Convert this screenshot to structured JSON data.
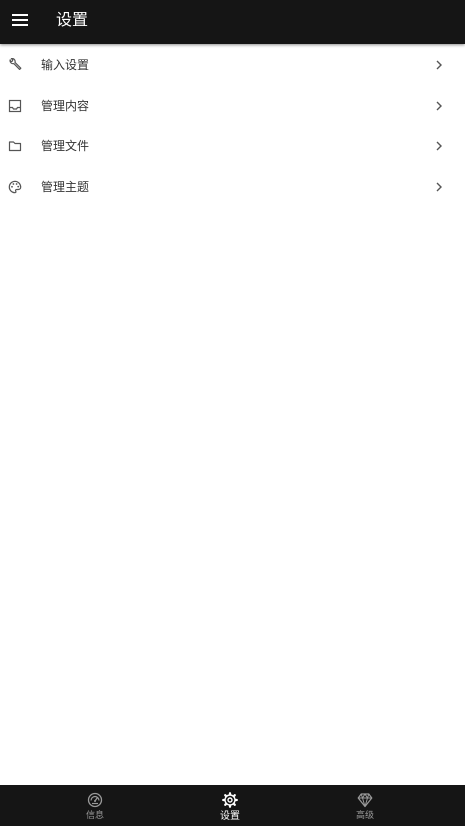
{
  "app_bar": {
    "title": "设置",
    "menu_icon": "hamburger-menu-icon"
  },
  "settings": {
    "items": [
      {
        "label": "输入设置",
        "icon": "wrench-icon"
      },
      {
        "label": "管理内容",
        "icon": "inbox-tray-icon"
      },
      {
        "label": "管理文件",
        "icon": "folder-icon"
      },
      {
        "label": "管理主题",
        "icon": "palette-icon"
      }
    ],
    "chevron_icon": "chevron-right-icon"
  },
  "bottom_nav": {
    "tabs": [
      {
        "label": "信息",
        "icon": "speedometer-icon",
        "active": false
      },
      {
        "label": "设置",
        "icon": "gear-icon",
        "active": true
      },
      {
        "label": "高级",
        "icon": "diamond-icon",
        "active": false
      }
    ]
  },
  "colors": {
    "bar_background": "#151515",
    "page_background": "#ffffff",
    "text_primary": "#333333",
    "icon_gray": "#555555",
    "nav_active": "#ffffff",
    "nav_inactive": "#9a9a9a"
  }
}
